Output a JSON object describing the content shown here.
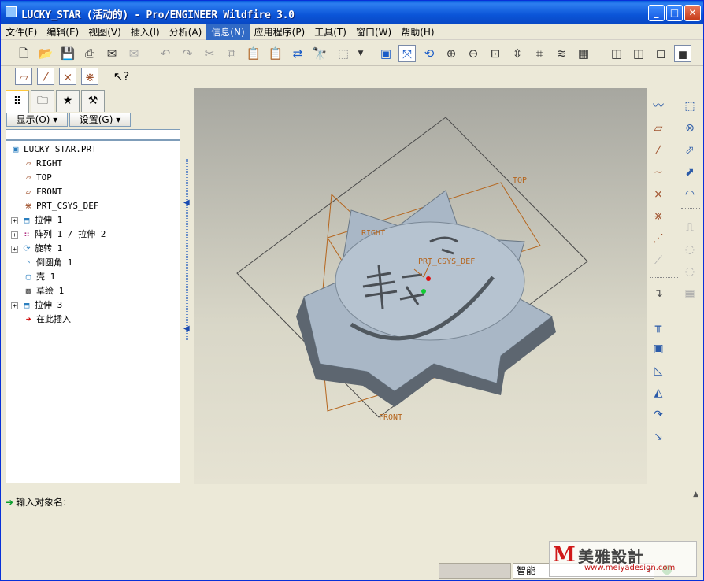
{
  "window": {
    "title": "LUCKY_STAR (活动的) - Pro/ENGINEER Wildfire 3.0",
    "min_symbol": "_",
    "max_symbol": "□",
    "close_symbol": "✕"
  },
  "menu": [
    {
      "label": "文件(F)",
      "active": false
    },
    {
      "label": "编辑(E)",
      "active": false
    },
    {
      "label": "视图(V)",
      "active": false
    },
    {
      "label": "插入(I)",
      "active": false
    },
    {
      "label": "分析(A)",
      "active": false
    },
    {
      "label": "信息(N)",
      "active": true
    },
    {
      "label": "应用程序(P)",
      "active": false
    },
    {
      "label": "工具(T)",
      "active": false
    },
    {
      "label": "窗口(W)",
      "active": false
    },
    {
      "label": "帮助(H)",
      "active": false
    }
  ],
  "toolbar1": {
    "icons": [
      "new-file-icon",
      "open-file-icon",
      "save-icon",
      "print-icon",
      "send-mail-icon",
      "mail-recipient-icon",
      "undo-icon",
      "redo-icon",
      "cut-icon",
      "copy-icon",
      "paste-icon",
      "paste-special-icon",
      "regenerate-icon",
      "find-icon",
      "select-box-icon",
      "repaint-icon",
      "spin-center-icon",
      "orient-mode-icon",
      "zoom-in-icon",
      "zoom-out-icon",
      "refit-icon",
      "reorient-icon",
      "saved-views-icon",
      "layers-icon",
      "view-manager-icon",
      "wireframe-icon",
      "hidden-line-icon",
      "no-hidden-icon",
      "shading-icon"
    ]
  },
  "toolbar2": {
    "icons": [
      "datum-plane-display-icon",
      "datum-axis-display-icon",
      "datum-point-display-icon",
      "csys-display-icon",
      "context-help-icon"
    ]
  },
  "left_panel": {
    "tabs": [
      "model-tree-tab",
      "folder-browser-tab",
      "favorites-tab",
      "connections-tab"
    ],
    "show_label": "显示(O)",
    "settings_label": "设置(G)"
  },
  "model_tree": [
    {
      "label": "LUCKY_STAR.PRT",
      "icon": "part-icon",
      "expandable": false,
      "indent": 0
    },
    {
      "label": "RIGHT",
      "icon": "datum-plane-icon",
      "expandable": false,
      "indent": 1
    },
    {
      "label": "TOP",
      "icon": "datum-plane-icon",
      "expandable": false,
      "indent": 1
    },
    {
      "label": "FRONT",
      "icon": "datum-plane-icon",
      "expandable": false,
      "indent": 1
    },
    {
      "label": "PRT_CSYS_DEF",
      "icon": "csys-icon",
      "expandable": false,
      "indent": 1
    },
    {
      "label": "拉伸 1",
      "icon": "extrude-icon",
      "expandable": true,
      "indent": 1
    },
    {
      "label": "阵列 1 / 拉伸 2",
      "icon": "pattern-icon",
      "expandable": true,
      "indent": 1
    },
    {
      "label": "旋转 1",
      "icon": "revolve-icon",
      "expandable": true,
      "indent": 1
    },
    {
      "label": "倒圆角 1",
      "icon": "round-icon",
      "expandable": false,
      "indent": 1
    },
    {
      "label": "壳 1",
      "icon": "shell-icon",
      "expandable": false,
      "indent": 1
    },
    {
      "label": "草绘 1",
      "icon": "sketch-icon",
      "expandable": false,
      "indent": 1
    },
    {
      "label": "拉伸 3",
      "icon": "extrude-icon",
      "expandable": true,
      "indent": 1
    },
    {
      "label": "在此插入",
      "icon": "insert-here-icon",
      "expandable": false,
      "indent": 1
    }
  ],
  "viewport": {
    "datum_labels": {
      "right": "RIGHT",
      "top": "TOP",
      "front": "FRONT",
      "csys": "PRT_CSYS_DEF"
    },
    "datum_color": "#b5651d",
    "model_color": "#a9b7c6"
  },
  "right_toolbar": {
    "icons": [
      "datum-curve-sketch-icon",
      "datum-plane-tool-icon",
      "datum-axis-tool-icon",
      "datum-curve-icon",
      "datum-point-icon",
      "datum-csys-icon",
      "analysis-feature-icon",
      "insert-feature-icon",
      "hole-icon",
      "shell-tool-icon",
      "rib-icon",
      "draft-icon",
      "round-tool-icon",
      "chamfer-icon",
      "extrude-tool-icon",
      "revolve-tool-icon",
      "variable-sweep-icon",
      "boundary-blend-icon",
      "style-icon",
      "copy-feature-icon",
      "merge-icon",
      "trim-icon",
      "pattern-tool-icon"
    ]
  },
  "message": {
    "prompt": "输入对象名:"
  },
  "status": {
    "filter_value": "智能"
  },
  "watermark": {
    "logo_mark": "M",
    "name": "美雅設計",
    "url": "www.meiyadesign.com"
  }
}
